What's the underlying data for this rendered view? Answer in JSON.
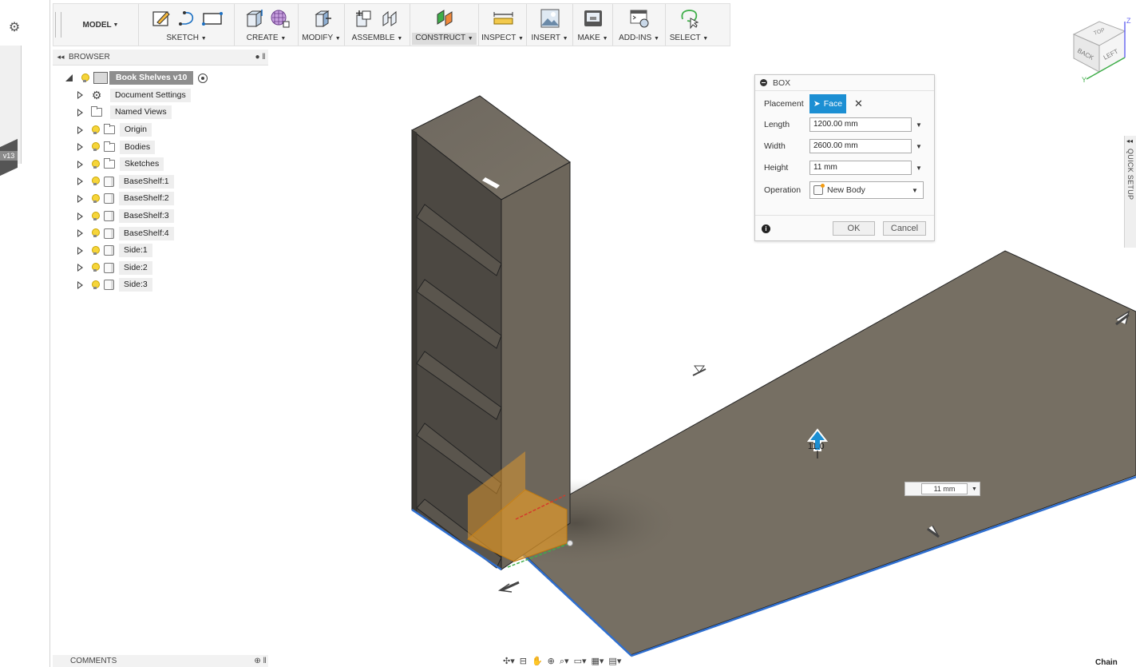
{
  "toolbar": {
    "workspace": "MODEL",
    "groups": [
      {
        "label": "SKETCH",
        "icons": [
          "sketch-create-icon",
          "arc-icon",
          "rectangle-icon"
        ]
      },
      {
        "label": "CREATE",
        "icons": [
          "extrude-icon",
          "form-icon"
        ]
      },
      {
        "label": "MODIFY",
        "icons": [
          "press-pull-icon"
        ]
      },
      {
        "label": "ASSEMBLE",
        "icons": [
          "new-component-icon",
          "joint-icon"
        ]
      },
      {
        "label": "CONSTRUCT",
        "icons": [
          "plane-icon"
        ]
      },
      {
        "label": "INSPECT",
        "icons": [
          "measure-icon"
        ]
      },
      {
        "label": "INSERT",
        "icons": [
          "insert-image-icon"
        ]
      },
      {
        "label": "MAKE",
        "icons": [
          "make-3dprint-icon"
        ]
      },
      {
        "label": "ADD-INS",
        "icons": [
          "scripts-icon"
        ]
      },
      {
        "label": "SELECT",
        "icons": [
          "select-lasso-icon"
        ]
      }
    ],
    "active_group": "CONSTRUCT"
  },
  "left_strip": {
    "version_tag": "v13"
  },
  "browser": {
    "title": "BROWSER",
    "root": "Book Shelves v10",
    "items": [
      {
        "label": "Document Settings",
        "kind": "settings"
      },
      {
        "label": "Named Views",
        "kind": "folder-plain"
      },
      {
        "label": "Origin",
        "kind": "folder"
      },
      {
        "label": "Bodies",
        "kind": "folder"
      },
      {
        "label": "Sketches",
        "kind": "folder"
      },
      {
        "label": "BaseShelf:1",
        "kind": "body"
      },
      {
        "label": "BaseShelf:2",
        "kind": "body"
      },
      {
        "label": "BaseShelf:3",
        "kind": "body"
      },
      {
        "label": "BaseShelf:4",
        "kind": "body"
      },
      {
        "label": "Side:1",
        "kind": "body"
      },
      {
        "label": "Side:2",
        "kind": "body"
      },
      {
        "label": "Side:3",
        "kind": "body"
      }
    ]
  },
  "comments": {
    "title": "COMMENTS"
  },
  "box_dialog": {
    "title": "BOX",
    "placement_label": "Placement",
    "placement_value": "Face",
    "length_label": "Length",
    "length_value": "1200.00 mm",
    "width_label": "Width",
    "width_value": "2600.00 mm",
    "height_label": "Height",
    "height_value": "11 mm",
    "operation_label": "Operation",
    "operation_value": "New Body",
    "ok_label": "OK",
    "cancel_label": "Cancel"
  },
  "viewport": {
    "dimension_value": "11 mm",
    "manipulator_value": "11.0"
  },
  "viewcube": {
    "faces": [
      "TOP",
      "BACK",
      "LEFT"
    ],
    "axes": [
      "Z",
      "Y"
    ]
  },
  "quick_setup": {
    "label": "QUICK SETUP"
  },
  "status": {
    "selection_mode": "Chain"
  },
  "colors": {
    "accent": "#1c8fd3",
    "body_fill": "#7a7264",
    "body_dark": "#5a554e",
    "edge": "#222222",
    "selected_edge": "#2f6fd0"
  }
}
